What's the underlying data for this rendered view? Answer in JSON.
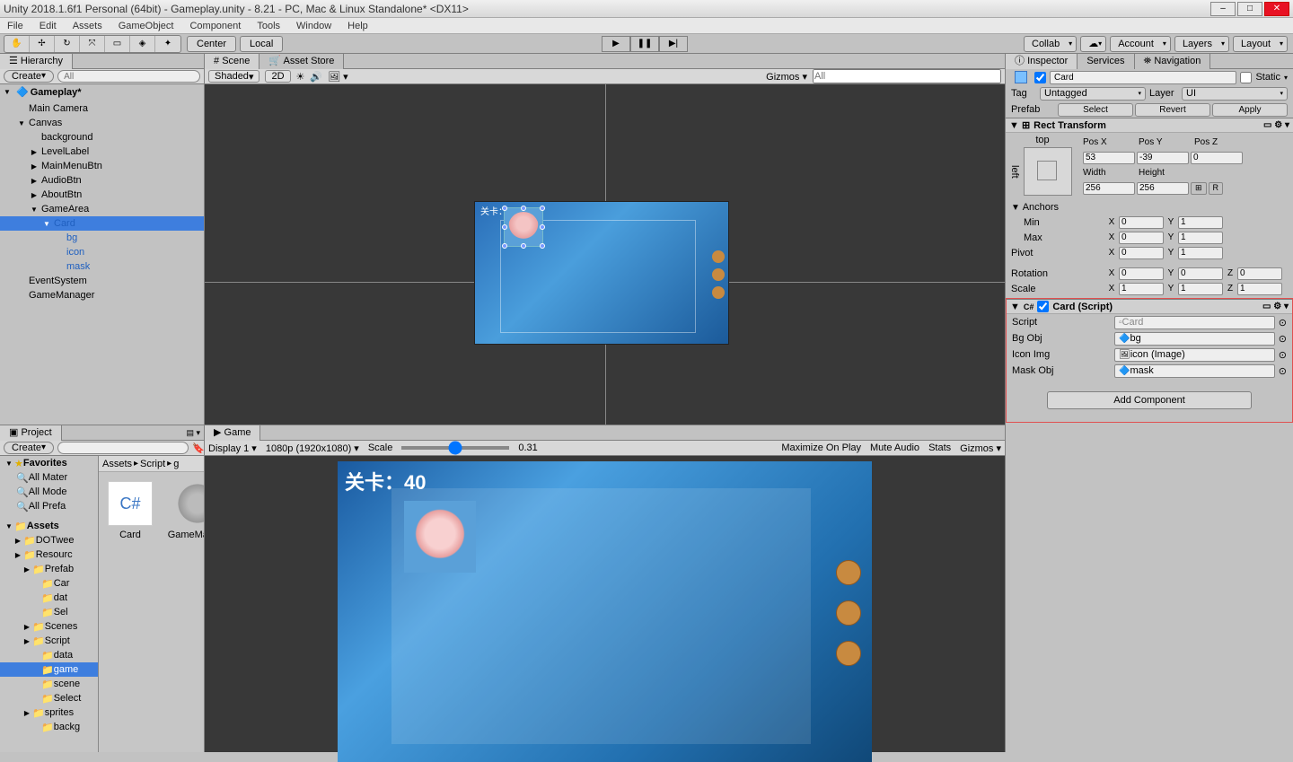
{
  "titlebar": "Unity 2018.1.6f1 Personal (64bit) - Gameplay.unity - 8.21 - PC, Mac & Linux Standalone* <DX11>",
  "menu": [
    "File",
    "Edit",
    "Assets",
    "GameObject",
    "Component",
    "Tools",
    "Window",
    "Help"
  ],
  "toolbar": {
    "center": "Center",
    "local": "Local",
    "collab": "Collab",
    "account": "Account",
    "layers": "Layers",
    "layout": "Layout"
  },
  "hierarchy": {
    "tab": "Hierarchy",
    "create": "Create",
    "search_placeholder": "All",
    "scene": "Gameplay*",
    "items": [
      {
        "label": "Main Camera",
        "depth": 1,
        "arrow": ""
      },
      {
        "label": "Canvas",
        "depth": 1,
        "arrow": "▼"
      },
      {
        "label": "background",
        "depth": 2,
        "arrow": ""
      },
      {
        "label": "LevelLabel",
        "depth": 2,
        "arrow": "▶"
      },
      {
        "label": "MainMenuBtn",
        "depth": 2,
        "arrow": "▶"
      },
      {
        "label": "AudioBtn",
        "depth": 2,
        "arrow": "▶"
      },
      {
        "label": "AboutBtn",
        "depth": 2,
        "arrow": "▶"
      },
      {
        "label": "GameArea",
        "depth": 2,
        "arrow": "▼"
      },
      {
        "label": "Card",
        "depth": 3,
        "arrow": "▼",
        "pref": true,
        "selected": true
      },
      {
        "label": "bg",
        "depth": 4,
        "arrow": "",
        "pref": true
      },
      {
        "label": "icon",
        "depth": 4,
        "arrow": "",
        "pref": true
      },
      {
        "label": "mask",
        "depth": 4,
        "arrow": "",
        "pref": true
      },
      {
        "label": "EventSystem",
        "depth": 1,
        "arrow": ""
      },
      {
        "label": "GameManager",
        "depth": 1,
        "arrow": ""
      }
    ]
  },
  "scene": {
    "tab_scene": "Scene",
    "tab_assetstore": "Asset Store",
    "shaded": "Shaded",
    "twod": "2D",
    "gizmos": "Gizmos",
    "search_placeholder": "All",
    "level_label": "关卡：40"
  },
  "game": {
    "tab": "Game",
    "display": "Display 1",
    "resolution": "1080p (1920x1080)",
    "scale_label": "Scale",
    "scale_value": "0.31",
    "max_on_play": "Maximize On Play",
    "mute": "Mute Audio",
    "stats": "Stats",
    "gizmos": "Gizmos",
    "level_label": "关卡：40"
  },
  "project": {
    "tab": "Project",
    "create": "Create",
    "favorites": "Favorites",
    "fav_items": [
      "All Mater",
      "All Mode",
      "All Prefa"
    ],
    "assets": "Assets",
    "folders": [
      "DOTwee",
      "Resourc",
      " Prefab",
      "  Car",
      "  dat",
      "  Sel",
      " Scenes",
      " Script",
      "  data",
      "  game",
      "  scene",
      "  Select",
      " sprites",
      "  backg"
    ],
    "selected_folder": "game",
    "breadcrumb": [
      "Assets",
      "Script",
      "g"
    ],
    "items": [
      {
        "name": "Card",
        "type": "cs"
      },
      {
        "name": "GameMana...",
        "type": "gear"
      }
    ]
  },
  "inspector": {
    "tab_inspector": "Inspector",
    "tab_services": "Services",
    "tab_nav": "Navigation",
    "name": "Card",
    "static": "Static",
    "tag_label": "Tag",
    "tag": "Untagged",
    "layer_label": "Layer",
    "layer": "UI",
    "prefab_label": "Prefab",
    "prefab_btns": [
      "Select",
      "Revert",
      "Apply"
    ],
    "rect_transform": "Rect Transform",
    "anchor_top": "top",
    "anchor_left": "left",
    "posx_label": "Pos X",
    "posy_label": "Pos Y",
    "posz_label": "Pos Z",
    "posx": "53",
    "posy": "-39",
    "posz": "0",
    "width_label": "Width",
    "height_label": "Height",
    "width": "256",
    "height": "256",
    "anchors": "Anchors",
    "min": "Min",
    "max": "Max",
    "pivot": "Pivot",
    "min_x": "0",
    "min_y": "1",
    "max_x": "0",
    "max_y": "1",
    "pivot_x": "0",
    "pivot_y": "1",
    "rotation": "Rotation",
    "scale": "Scale",
    "rot_x": "0",
    "rot_y": "0",
    "rot_z": "0",
    "scl_x": "1",
    "scl_y": "1",
    "scl_z": "1",
    "card_script_header": "Card (Script)",
    "script_label": "Script",
    "script_value": "Card",
    "bg_label": "Bg Obj",
    "bg_value": "bg",
    "icon_label": "Icon Img",
    "icon_value": "icon (Image)",
    "mask_label": "Mask Obj",
    "mask_value": "mask",
    "add_component": "Add Component"
  }
}
